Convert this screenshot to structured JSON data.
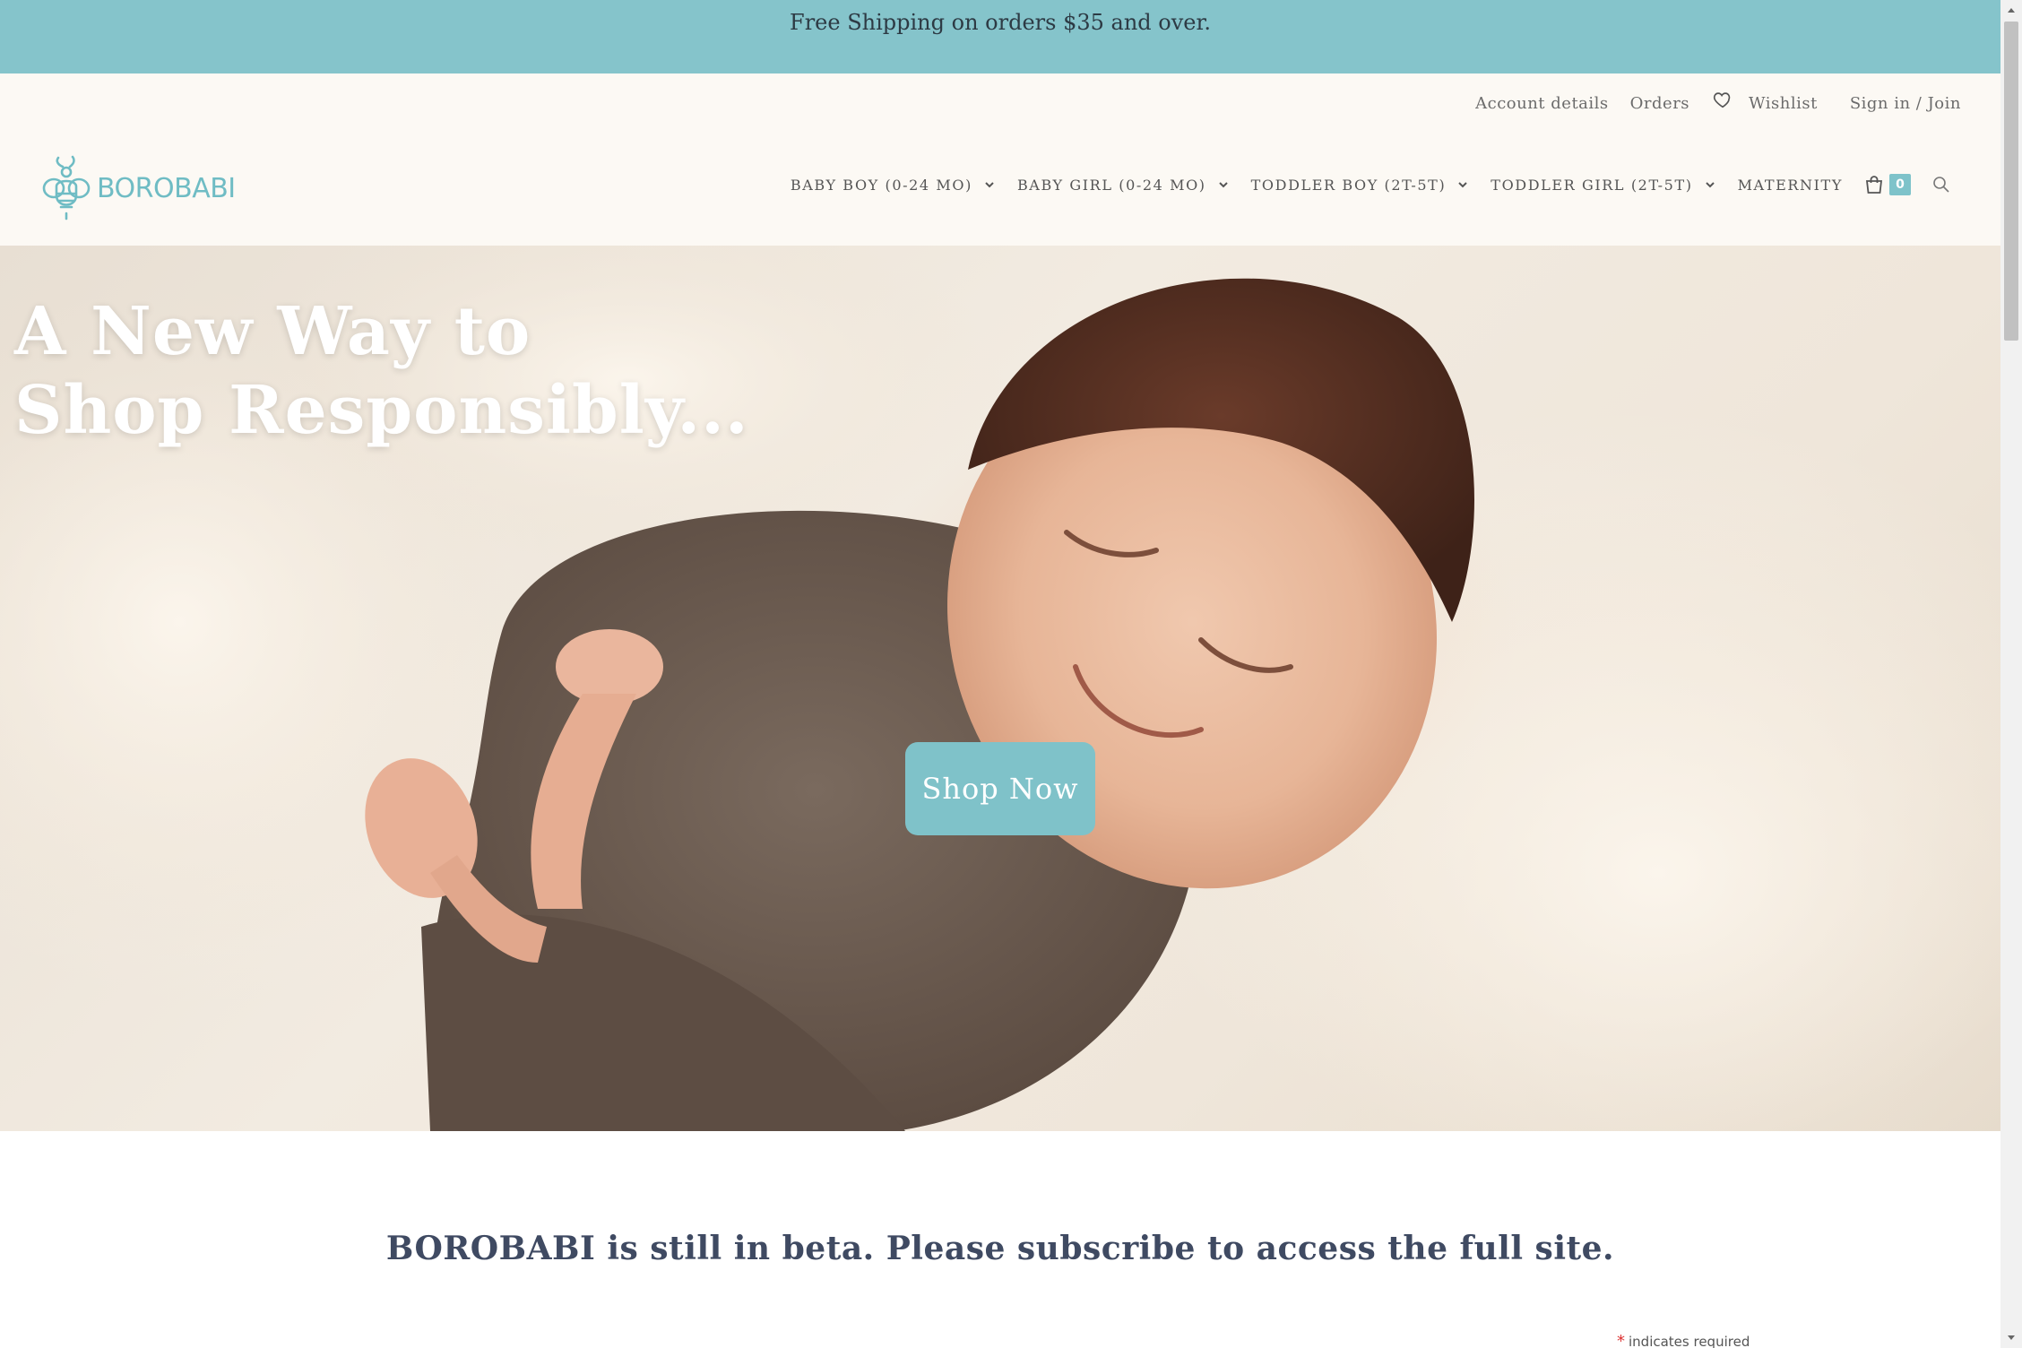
{
  "promo": {
    "text": "Free Shipping on orders $35 and over."
  },
  "header": {
    "top_links": {
      "account": "Account details",
      "orders": "Orders",
      "wishlist": "Wishlist",
      "signin": "Sign in / Join"
    },
    "logo_text": "BOROBABI",
    "nav": [
      {
        "label": "BABY BOY (0-24 MO)"
      },
      {
        "label": "BABY GIRL (0-24 MO)"
      },
      {
        "label": "TODDLER BOY (2T-5T)"
      },
      {
        "label": "TODDLER GIRL (2T-5T)"
      },
      {
        "label": "MATERNITY"
      }
    ],
    "cart_count": "0"
  },
  "hero": {
    "headline_line1": "A New Way to",
    "headline_line2": "Shop Responsibly...",
    "button_label": "Shop Now"
  },
  "beta": {
    "message": "BOROBABI is still in beta. Please subscribe to access the full site.",
    "required_star": "*",
    "required_note": "indicates required"
  },
  "colors": {
    "accent": "#85c4cb",
    "header_bg": "#fcf9f4",
    "heading_text": "#3f4a62"
  }
}
